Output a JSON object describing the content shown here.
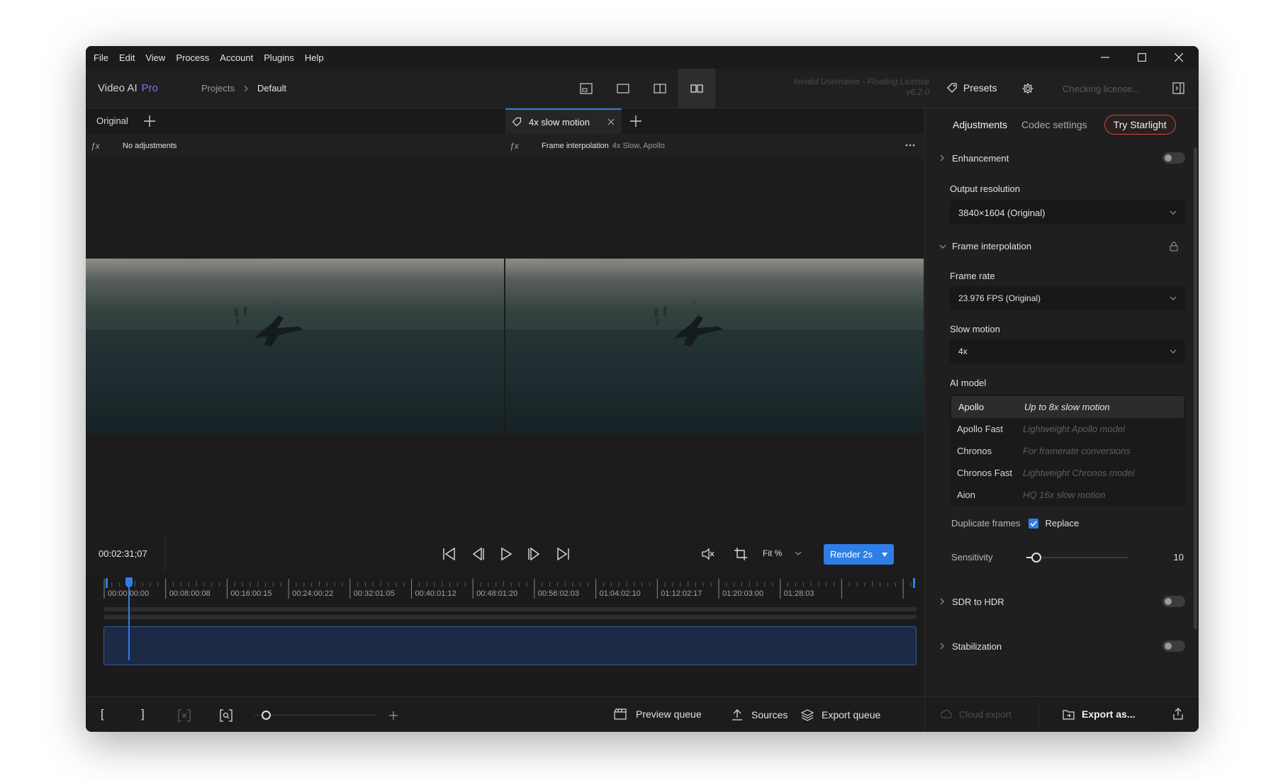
{
  "menu": [
    "File",
    "Edit",
    "View",
    "Process",
    "Account",
    "Plugins",
    "Help"
  ],
  "toolbar": {
    "app_name": "Video AI",
    "app_tier": "Pro",
    "breadcrumb": [
      "Projects",
      "Default"
    ],
    "license_line1": "Invalid Username - Floating License",
    "license_line2": "v6.2.0",
    "presets_label": "Presets",
    "license_status": "Checking license..."
  },
  "tabs": {
    "original_label": "Original",
    "preview_tab_label": "4x slow motion"
  },
  "subbar": {
    "left_text": "No adjustments",
    "right_title": "Frame interpolation",
    "right_detail": "4x Slow, Apollo"
  },
  "controls": {
    "timecode": "00:02:31;07",
    "fit_label": "Fit %",
    "render_label": "Render 2s"
  },
  "timeline": {
    "ticks": [
      "00:00:00:00",
      "00:08:00:08",
      "00:16:00:15",
      "00:24:00:22",
      "00:32:01:05",
      "00:40:01:12",
      "00:48:01:20",
      "00:56:02:03",
      "01:04:02:10",
      "01:12:02:17",
      "01:20:03:00",
      "01:28:03"
    ],
    "playhead_position": 0.03
  },
  "bottombar": {
    "preview_queue": "Preview queue",
    "sources": "Sources",
    "export_queue": "Export queue",
    "zoom_level": 0.1
  },
  "panel": {
    "tabs": [
      "Adjustments",
      "Codec settings"
    ],
    "try_label": "Try Starlight",
    "enhancement_label": "Enhancement",
    "output_resolution_label": "Output resolution",
    "output_resolution_value": "3840×1604 (Original)",
    "frame_interp_label": "Frame interpolation",
    "frame_rate_label": "Frame rate",
    "frame_rate_value": "23.976 FPS (Original)",
    "slow_motion_label": "Slow motion",
    "slow_motion_value": "4x",
    "ai_model_label": "AI model",
    "models": [
      {
        "name": "Apollo",
        "desc": "Up to 8x slow motion",
        "selected": true
      },
      {
        "name": "Apollo Fast",
        "desc": "Lightweight Apollo model",
        "selected": false
      },
      {
        "name": "Chronos",
        "desc": "For framerate conversions",
        "selected": false
      },
      {
        "name": "Chronos Fast",
        "desc": "Lightweight Chronos model",
        "selected": false
      },
      {
        "name": "Aion",
        "desc": "HQ 16x slow motion",
        "selected": false
      }
    ],
    "duplicate_frames_label": "Duplicate frames",
    "replace_label": "Replace",
    "replace_checked": true,
    "sensitivity_label": "Sensitivity",
    "sensitivity_value": "10",
    "sensitivity_max": 100,
    "sdr_label": "SDR to HDR",
    "stabilization_label": "Stabilization",
    "cloud_export_label": "Cloud export",
    "export_as_label": "Export as..."
  },
  "colors": {
    "accent": "#2f7ee6",
    "try_border": "#d8453a",
    "brand_pro": "#8a6cf2",
    "clip": "#1d2a45"
  }
}
